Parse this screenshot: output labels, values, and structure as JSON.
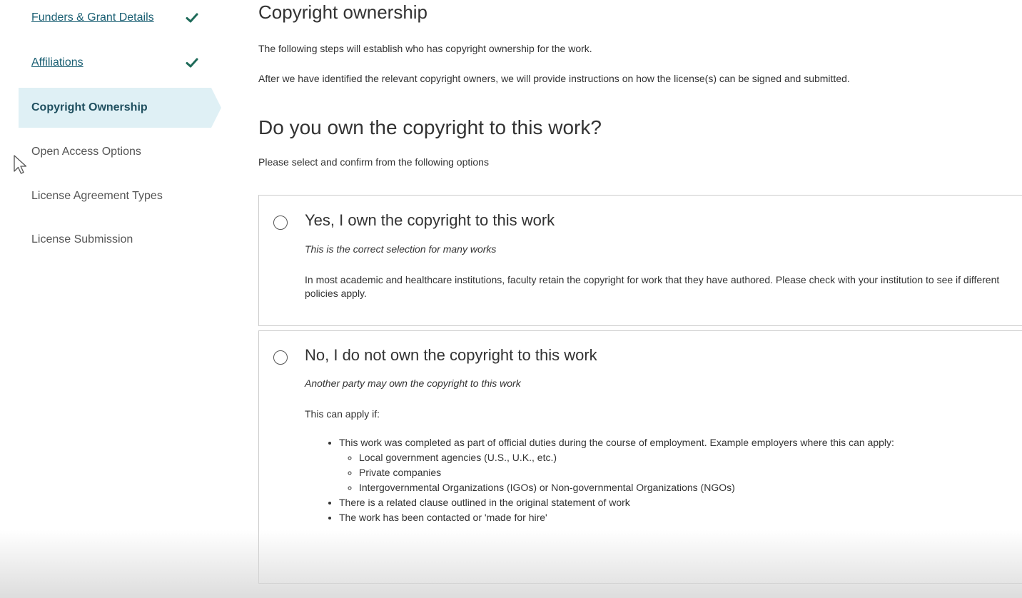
{
  "sidebar": {
    "items": [
      {
        "label": "Funders & Grant Details",
        "state": "done"
      },
      {
        "label": "Affiliations",
        "state": "done"
      },
      {
        "label": "Copyright Ownership",
        "state": "active"
      },
      {
        "label": "Open Access Options",
        "state": "todo"
      },
      {
        "label": "License Agreement Types",
        "state": "todo"
      },
      {
        "label": "License Submission",
        "state": "todo"
      }
    ]
  },
  "main": {
    "title": "Copyright ownership",
    "intro1": "The following steps will establish who has copyright ownership for the work.",
    "intro2": "After we have identified the relevant copyright owners, we will provide instructions on how the license(s) can be signed and submitted.",
    "question": "Do you own the copyright to this work?",
    "instruction": "Please select and confirm from the following options",
    "options": [
      {
        "title": "Yes, I own the copyright to this work",
        "subtitle": "This is the correct selection for many works",
        "text": "In most academic and healthcare institutions, faculty retain the copyright for work that they have authored. Please check with your institution to see if different policies apply."
      },
      {
        "title": "No, I do not own the copyright to this work",
        "subtitle": "Another party may own the copyright to this work",
        "text": "This can apply if:",
        "bullets": [
          "This work was completed as part of official duties during the course of employment. Example employers where this can apply:",
          "There is a related clause outlined in the original statement of work",
          "The work has been contacted or 'made for hire'"
        ],
        "sub_bullets": [
          "Local government agencies (U.S., U.K., etc.)",
          "Private companies",
          "Intergovernmental Organizations (IGOs) or Non-governmental Organizations (NGOs)"
        ]
      }
    ]
  },
  "colors": {
    "accent": "#1a5f73",
    "check": "#1f6b5a",
    "active_bg": "#dff0f5"
  }
}
